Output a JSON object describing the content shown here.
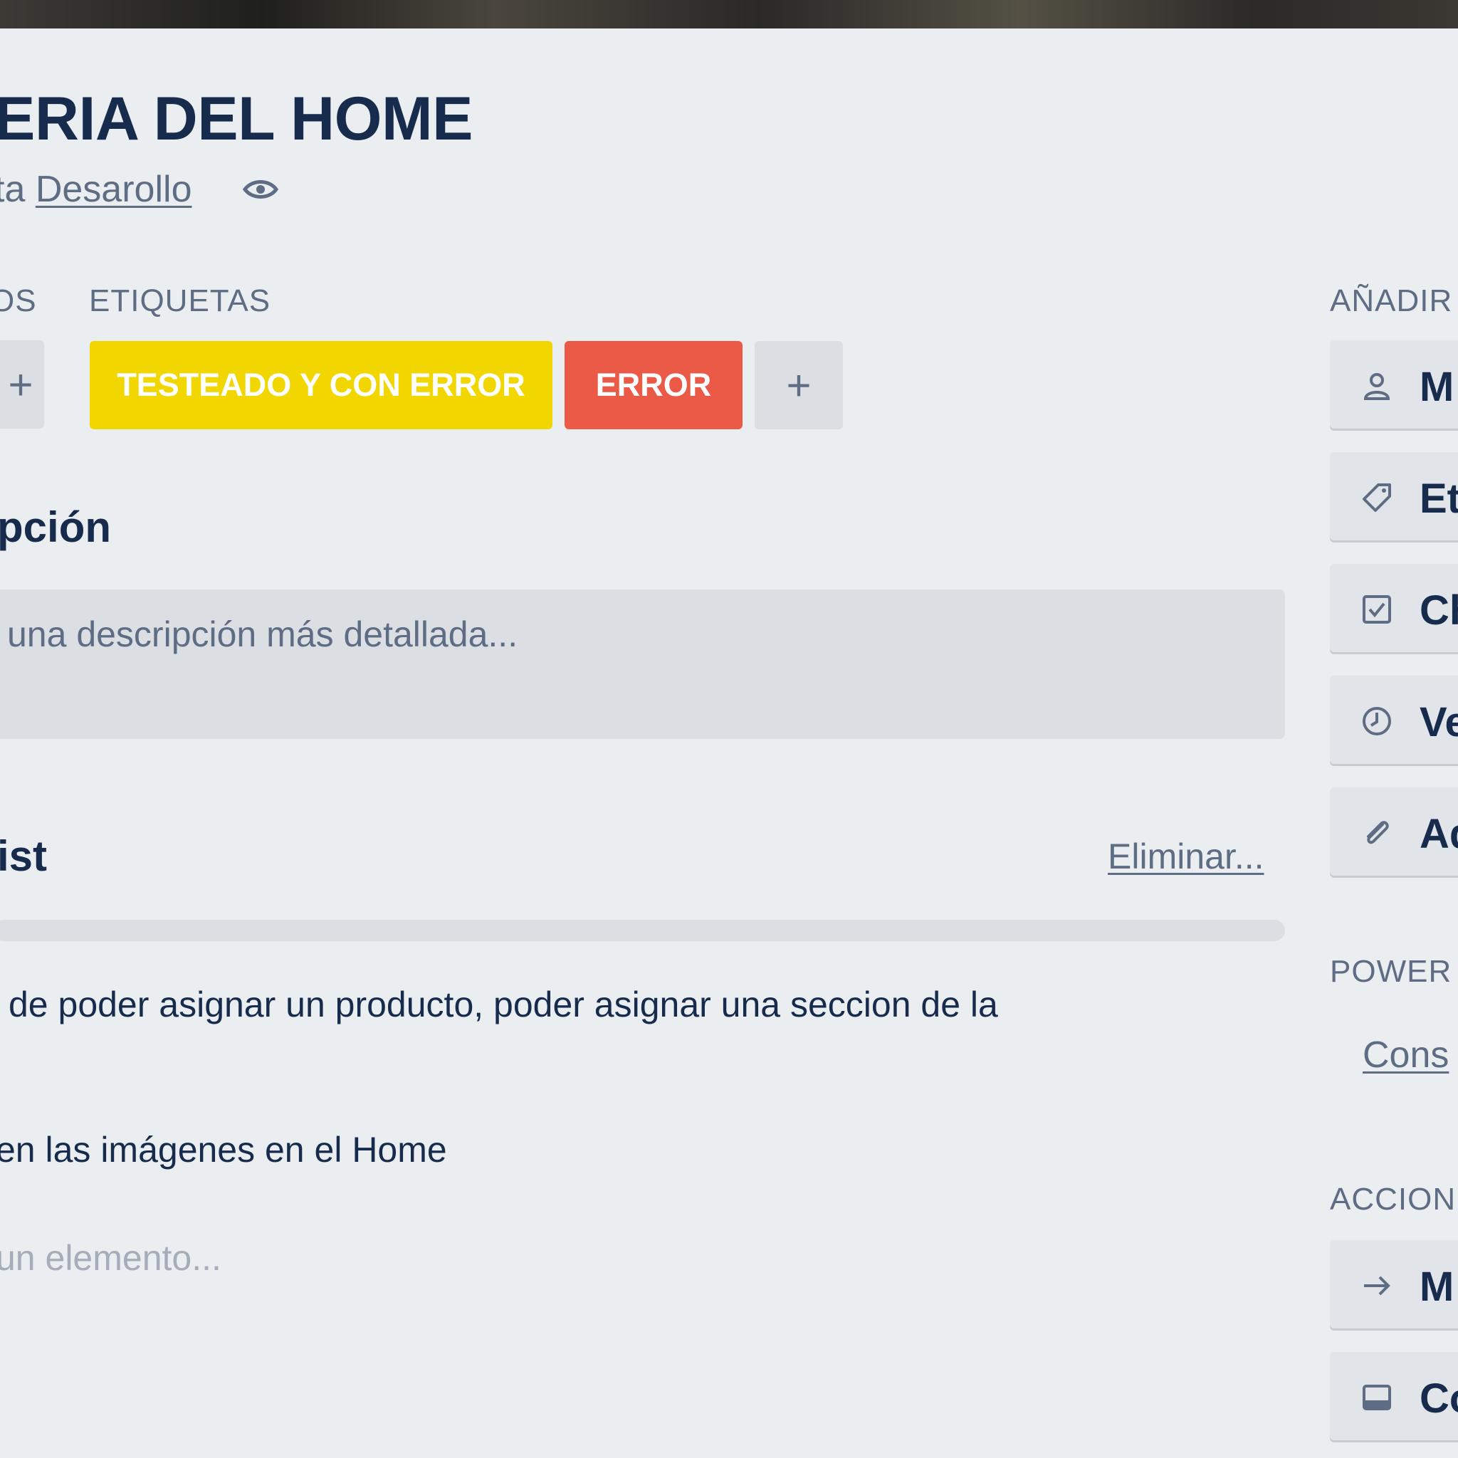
{
  "card": {
    "title": "ERIA DEL HOME",
    "list_prefix": "ta",
    "list_name": "Desarollo"
  },
  "members": {
    "label": "OS",
    "add_glyph": "+"
  },
  "labels": {
    "header": "ETIQUETAS",
    "items": [
      {
        "text": "TESTEADO Y CON ERROR",
        "color": "#f2d600"
      },
      {
        "text": "ERROR",
        "color": "#eb5a46"
      }
    ],
    "add_glyph": "+"
  },
  "description": {
    "heading": "pción",
    "placeholder": "una descripción más detallada..."
  },
  "checklist": {
    "heading": "ist",
    "delete_link": "Eliminar...",
    "progress": 0,
    "items": [
      {
        "text": "de poder asignar un producto, poder asignar una seccion de la"
      },
      {
        "text": "en las imágenes en el Home"
      }
    ],
    "add_placeholder": "un elemento..."
  },
  "sidebar": {
    "add_header": "AÑADIR",
    "add_buttons": [
      {
        "label": "M",
        "icon": "person-icon"
      },
      {
        "label": "Et",
        "icon": "tag-icon"
      },
      {
        "label": "Ch",
        "icon": "checkbox-icon"
      },
      {
        "label": "Ve",
        "icon": "clock-icon"
      },
      {
        "label": "Ad",
        "icon": "paperclip-icon"
      }
    ],
    "powerups_header": "POWER",
    "powerups_link": "Cons",
    "actions_header": "ACCION",
    "action_buttons": [
      {
        "label": "M",
        "icon": "arrow-right-icon"
      },
      {
        "label": "Co",
        "icon": "card-icon"
      }
    ]
  }
}
